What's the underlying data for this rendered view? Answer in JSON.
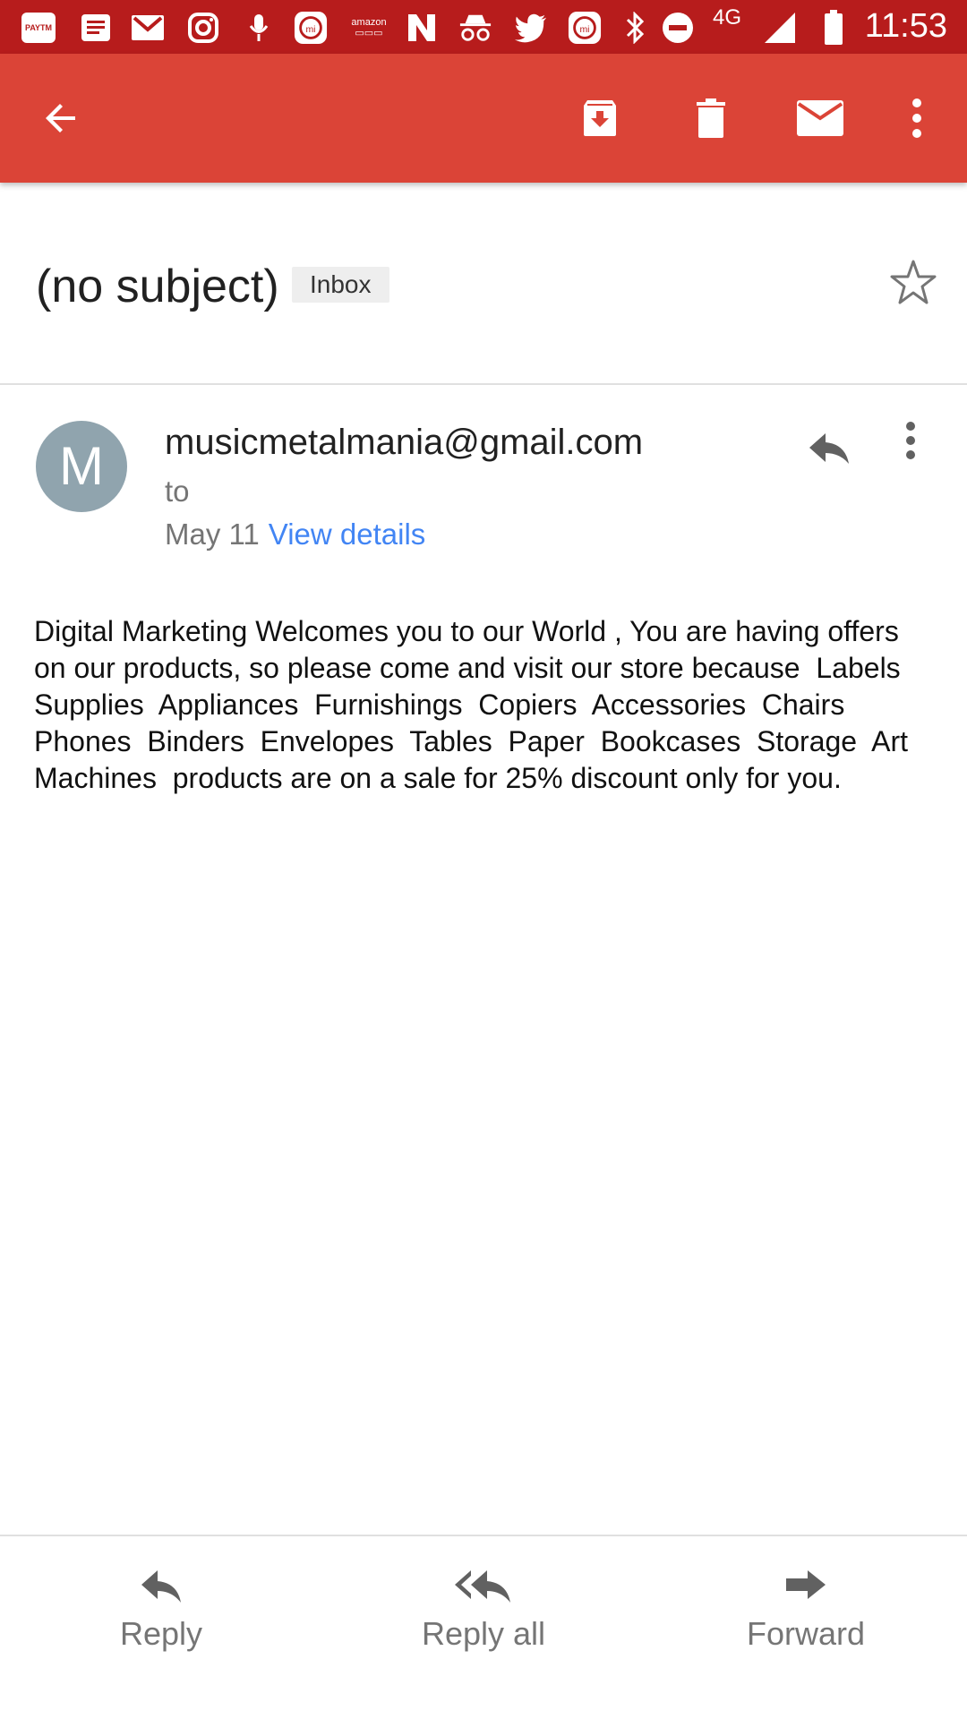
{
  "status_bar": {
    "app_icons": [
      "paytm-icon",
      "news-icon",
      "gmail-icon",
      "instagram-icon",
      "mic-icon",
      "mi-icon",
      "amazon-icon",
      "n-icon",
      "incognito-icon",
      "twitter-icon",
      "mi-icon"
    ],
    "paytm_label": "PAYTM",
    "amazon_label": "amazon",
    "network": "4G",
    "time": "11:53"
  },
  "toolbar": {
    "back_icon": "arrow-back-icon",
    "actions": [
      "archive-icon",
      "delete-icon",
      "mark-unread-icon",
      "more-vert-icon"
    ]
  },
  "email": {
    "subject": "(no subject)",
    "label": "Inbox",
    "sender_initial": "M",
    "sender": "musicmetalmania@gmail.com",
    "to": "to",
    "date": "May 11",
    "view_details": "View details",
    "body": "Digital Marketing Welcomes you to our World , You are having offers on our products, so please come and visit our store because  Labels  Supplies  Appliances  Furnishings  Copiers  Accessories  Chairs  Phones  Binders  Envelopes  Tables  Paper  Bookcases  Storage  Art  Machines  products are on a sale for 25% discount only for you."
  },
  "bottom_actions": {
    "reply": "Reply",
    "reply_all": "Reply all",
    "forward": "Forward"
  },
  "colors": {
    "status_bar": "#b71c1c",
    "app_bar": "#db4437",
    "link": "#4285f4",
    "avatar": "#90a4ae"
  }
}
